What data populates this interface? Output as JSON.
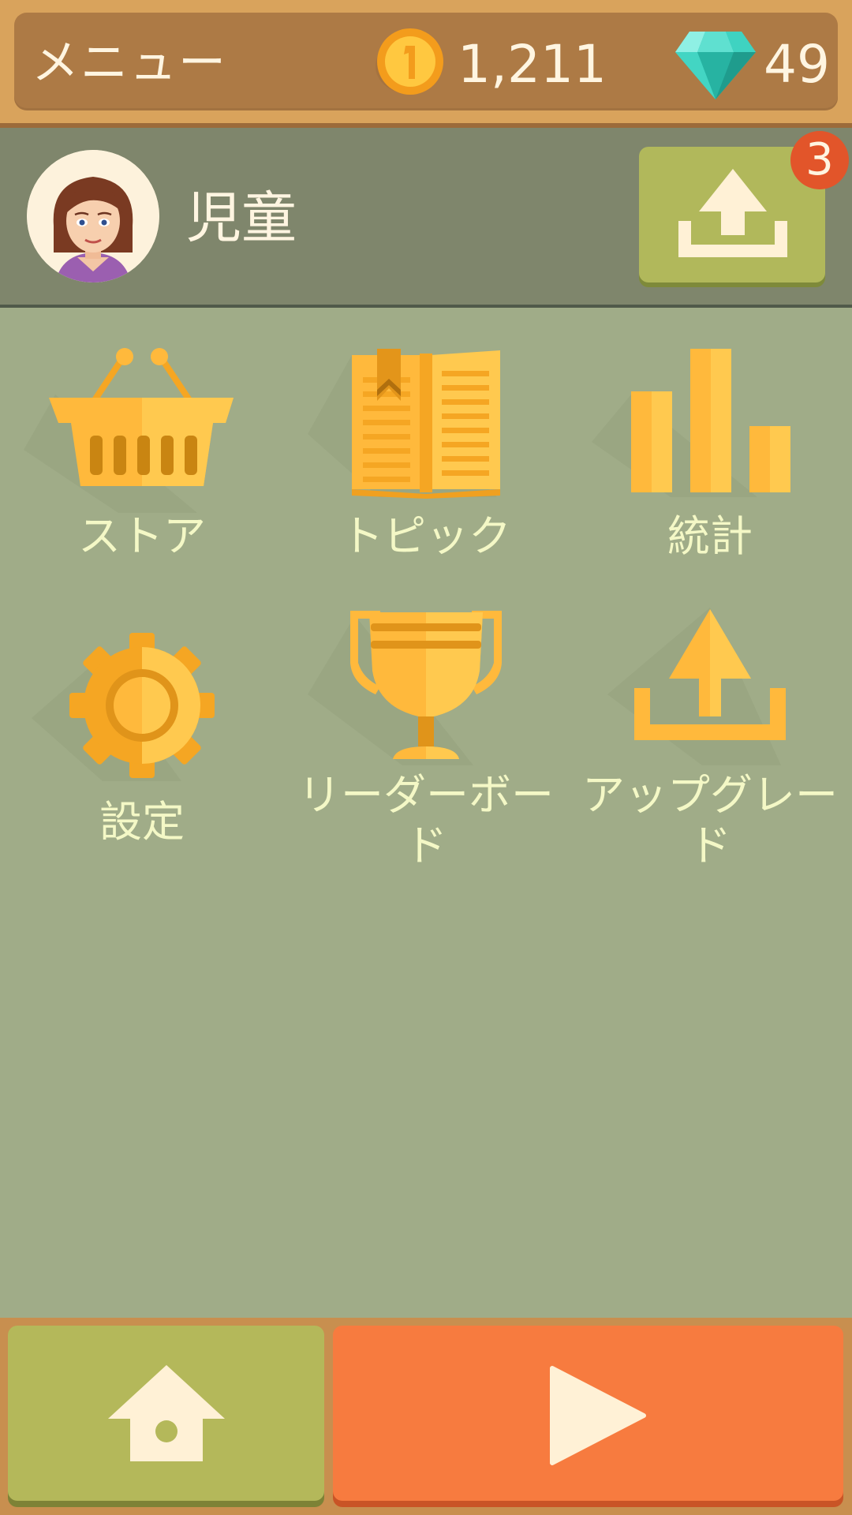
{
  "header": {
    "title": "メニュー",
    "coins": "1,211",
    "gems": "49",
    "coin_icon": "coin-icon",
    "gem_icon": "diamond-icon"
  },
  "profile": {
    "name": "児童",
    "avatar_icon": "avatar",
    "upload_icon": "upload-icon",
    "upload_badge": "3"
  },
  "menu": {
    "items": [
      {
        "label": "ストア",
        "icon": "basket-icon"
      },
      {
        "label": "トピック",
        "icon": "book-icon"
      },
      {
        "label": "統計",
        "icon": "bar-chart-icon"
      },
      {
        "label": "設定",
        "icon": "gear-icon"
      },
      {
        "label": "リーダーボード",
        "icon": "trophy-icon"
      },
      {
        "label": "アップグレード",
        "icon": "upload-icon"
      }
    ]
  },
  "bottom_nav": {
    "home_icon": "home-icon",
    "play_icon": "play-icon"
  },
  "colors": {
    "background": "#a0ac88",
    "topbar": "#ad7a45",
    "profile_bar": "#7f866c",
    "accent_green": "#b1b85b",
    "accent_orange": "#f77b3f",
    "icon_gold": "#ffb93c",
    "label_text": "#f4f8c6",
    "badge_red": "#e2552a"
  }
}
